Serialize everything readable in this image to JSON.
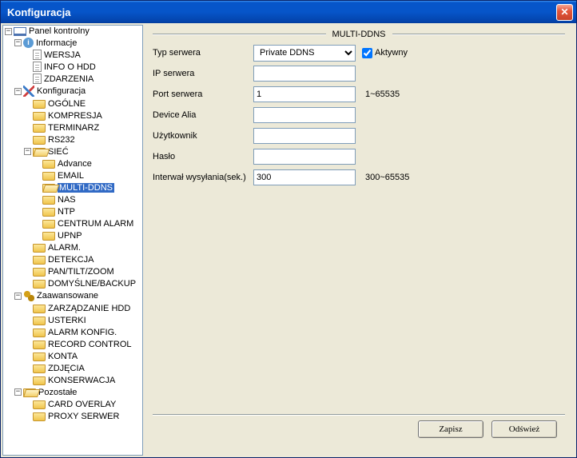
{
  "window": {
    "title": "Konfiguracja"
  },
  "tree": {
    "root": "Panel kontrolny",
    "info": {
      "label": "Informacje",
      "wersja": "WERSJA",
      "hdd": "INFO O HDD",
      "zdarzenia": "ZDARZENIA"
    },
    "konfig": {
      "label": "Konfiguracja",
      "ogolne": "OGÓLNE",
      "kompresja": "KOMPRESJA",
      "terminarz": "TERMINARZ",
      "rs232": "RS232",
      "siec": {
        "label": "SIEĆ",
        "advance": "Advance",
        "email": "EMAIL",
        "multiddns": "MULTI-DDNS",
        "nas": "NAS",
        "ntp": "NTP",
        "centrum": "CENTRUM ALARM",
        "upnp": "UPNP"
      },
      "alarm": "ALARM.",
      "detekcja": "DETEKCJA",
      "ptz": "PAN/TILT/ZOOM",
      "domyslne": "DOMYŚLNE/BACKUP"
    },
    "adv": {
      "label": "Zaawansowane",
      "hdd": "ZARZĄDZANIE HDD",
      "usterki": "USTERKI",
      "alarmk": "ALARM KONFIG.",
      "record": "RECORD CONTROL",
      "konta": "KONTA",
      "zdjecia": "ZDJĘCIA",
      "konserwacja": "KONSERWACJA"
    },
    "other": {
      "label": "Pozostałe",
      "card": "CARD OVERLAY",
      "proxy": "PROXY SERWER"
    }
  },
  "form": {
    "section_title": "MULTI-DDNS",
    "typ_label": "Typ serwera",
    "typ_value": "Private DDNS",
    "aktywny_label": "Aktywny",
    "ip_label": "IP serwera",
    "ip_value": "",
    "port_label": "Port serwera",
    "port_value": "1",
    "port_hint": "1~65535",
    "device_label": "Device Alia",
    "device_value": "",
    "user_label": "Użytkownik",
    "user_value": "",
    "pass_label": "Hasło",
    "pass_value": "",
    "interval_label": "Interwał wysyłania(sek.)",
    "interval_value": "300",
    "interval_hint": "300~65535"
  },
  "buttons": {
    "save": "Zapisz",
    "refresh": "Odśwież"
  }
}
